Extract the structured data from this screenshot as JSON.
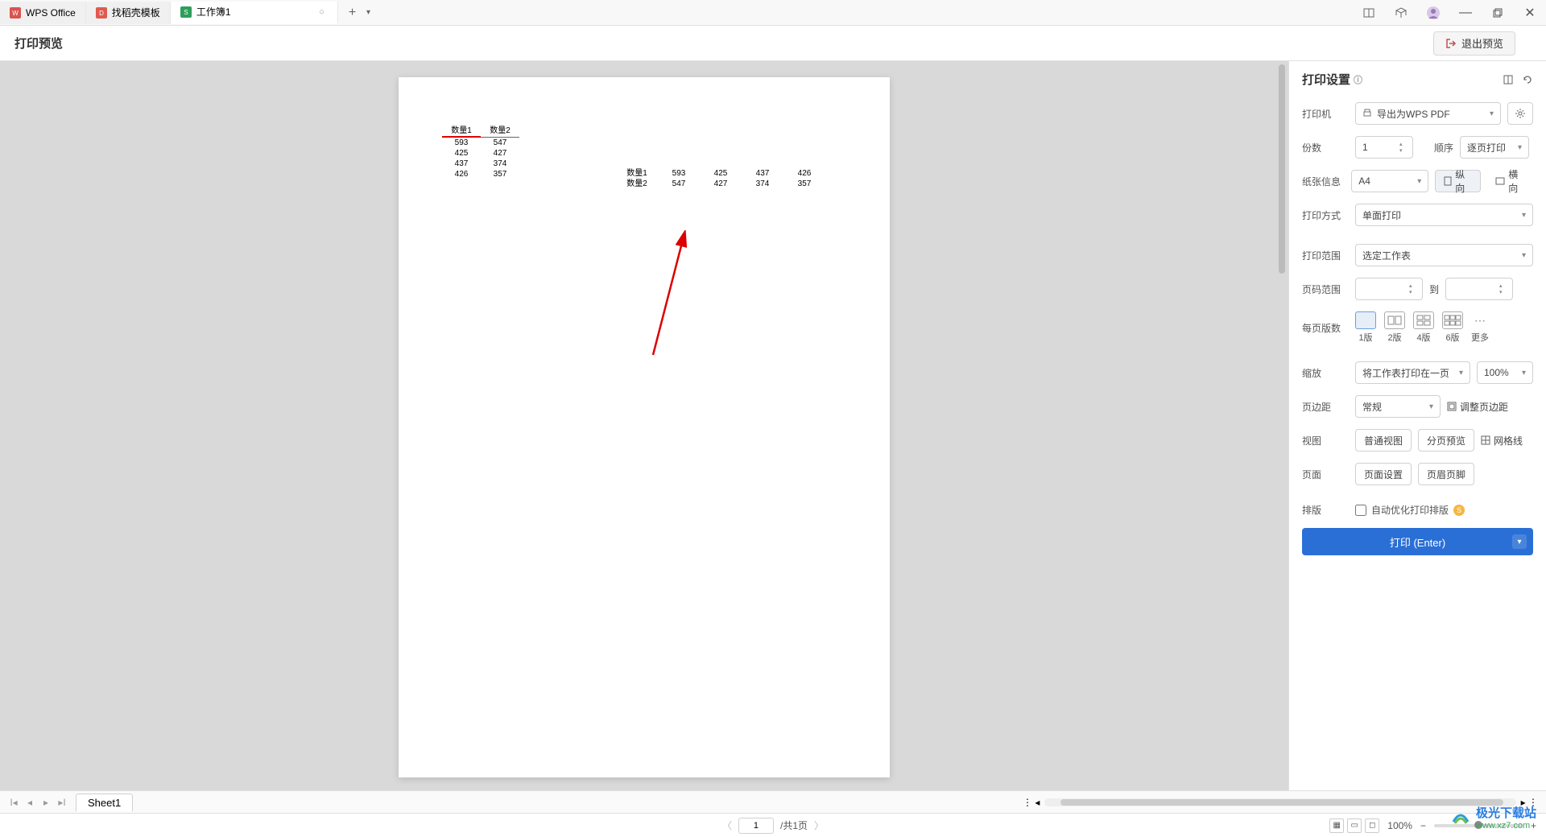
{
  "tabs": {
    "t0": {
      "label": "WPS Office"
    },
    "t1": {
      "label": "找稻壳模板"
    },
    "t2": {
      "label": "工作簿1"
    }
  },
  "header": {
    "title": "打印预览",
    "exit": "退出预览"
  },
  "preview": {
    "table1": {
      "headers": [
        "数量1",
        "数量2"
      ],
      "rows": [
        [
          "593",
          "547"
        ],
        [
          "425",
          "427"
        ],
        [
          "437",
          "374"
        ],
        [
          "426",
          "357"
        ]
      ]
    },
    "table2": {
      "rows": [
        [
          "数量1",
          "593",
          "425",
          "437",
          "426"
        ],
        [
          "数量2",
          "547",
          "427",
          "374",
          "357"
        ]
      ]
    }
  },
  "settings": {
    "title": "打印设置",
    "printer": {
      "label": "打印机",
      "value": "导出为WPS PDF"
    },
    "copies": {
      "label": "份数",
      "value": "1",
      "order_label": "顺序",
      "order_value": "逐页打印"
    },
    "paper": {
      "label": "纸张信息",
      "value": "A4",
      "portrait": "纵向",
      "landscape": "横向"
    },
    "duplex": {
      "label": "打印方式",
      "value": "单面打印"
    },
    "range": {
      "label": "打印范围",
      "value": "选定工作表"
    },
    "page_range": {
      "label": "页码范围",
      "to": "到"
    },
    "per_page": {
      "label": "每页版数",
      "v1": "1版",
      "v2": "2版",
      "v4": "4版",
      "v6": "6版",
      "more": "更多"
    },
    "scale": {
      "label": "缩放",
      "value": "将工作表打印在一页",
      "pct": "100%"
    },
    "margin": {
      "label": "页边距",
      "value": "常规",
      "adjust": "调整页边距"
    },
    "view": {
      "label": "视图",
      "normal": "普通视图",
      "paged": "分页预览",
      "grid": "网格线"
    },
    "page": {
      "label": "页面",
      "setup": "页面设置",
      "hf": "页眉页脚"
    },
    "layout_opt": {
      "label": "排版",
      "auto": "自动优化打印排版"
    },
    "print_btn": "打印 (Enter)"
  },
  "sheet": {
    "name": "Sheet1"
  },
  "status": {
    "page_value": "1",
    "page_total": "/共1页",
    "zoom": "100%"
  },
  "watermark": {
    "name": "极光下载站",
    "url": "www.xz7.com"
  }
}
